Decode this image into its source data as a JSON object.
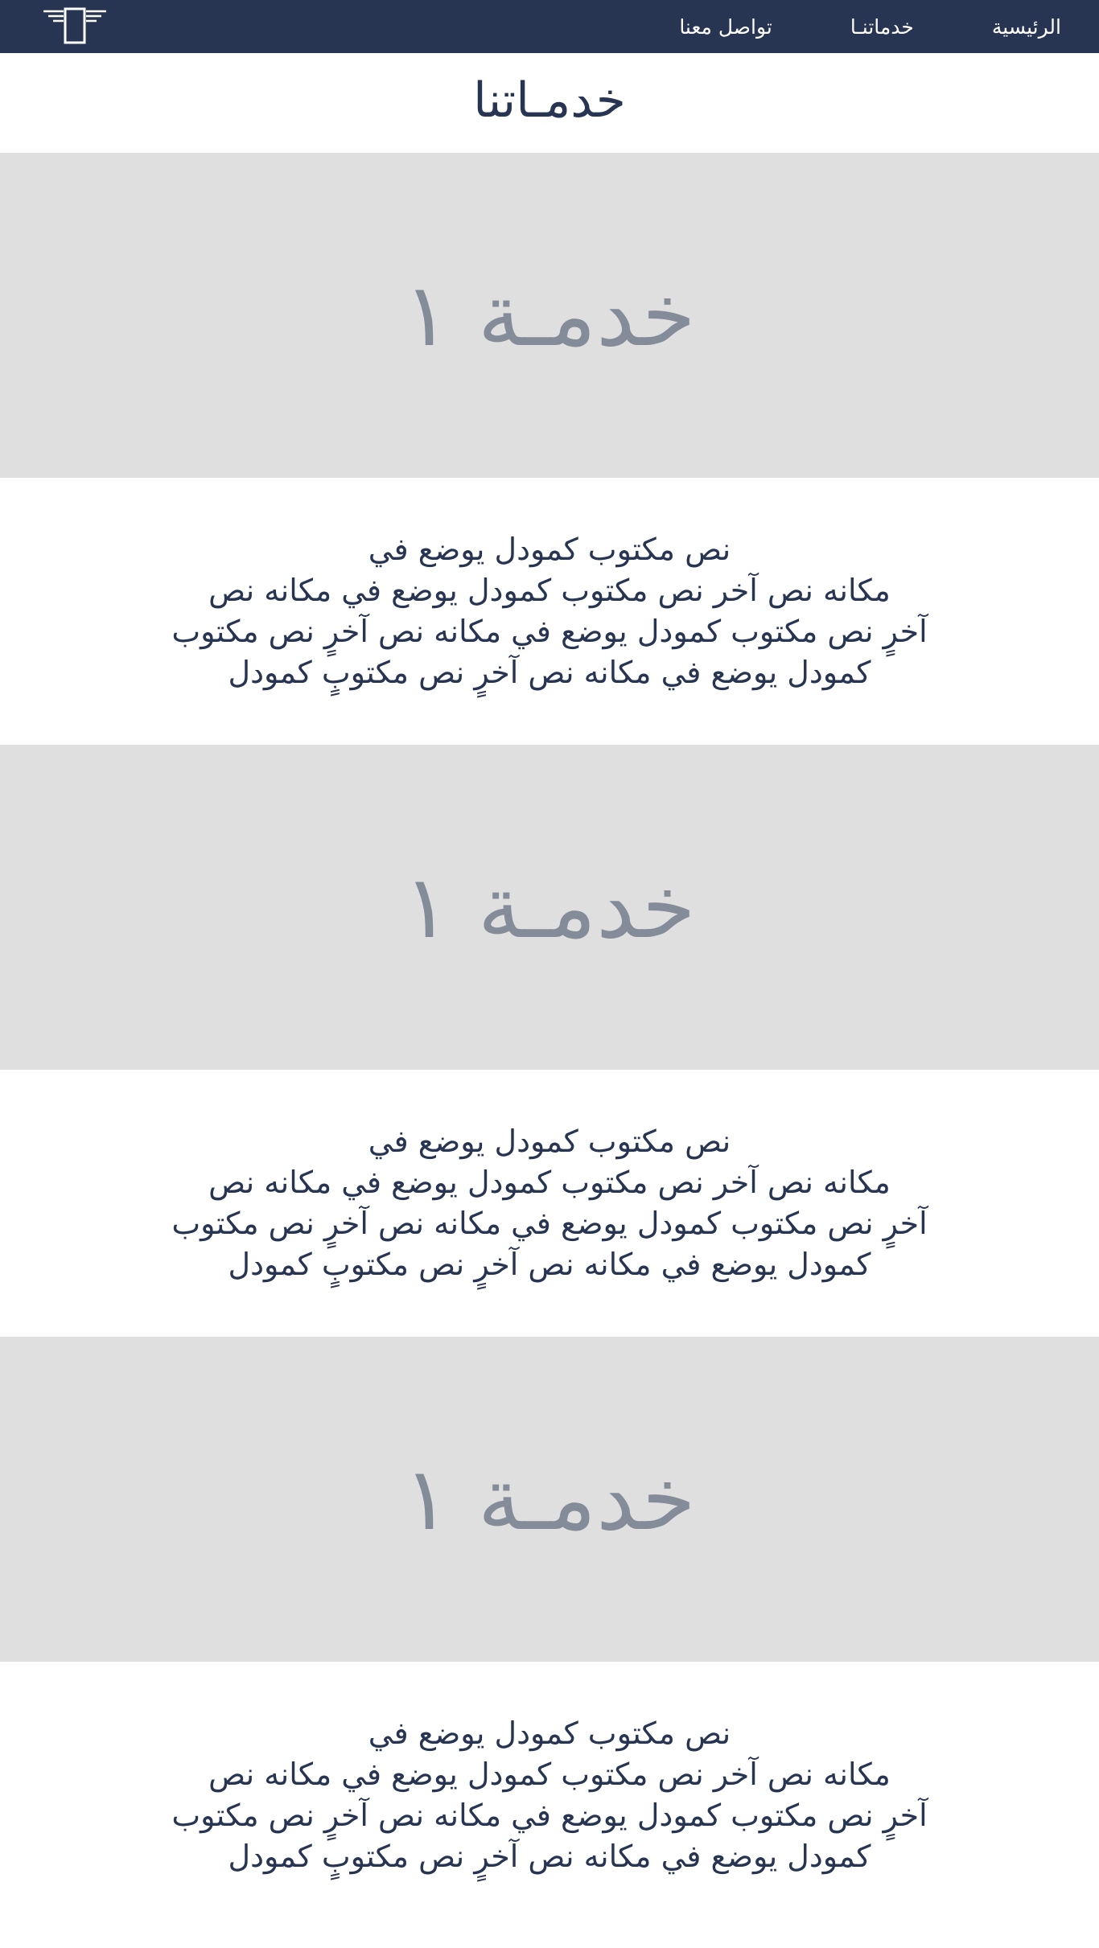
{
  "nav": {
    "items": [
      {
        "label": "الرئيسية"
      },
      {
        "label": "خدماتنـا"
      },
      {
        "label": "تواصل معنا"
      }
    ]
  },
  "page": {
    "title": "خدمـاتنا"
  },
  "services": [
    {
      "banner": "خدمـة ١",
      "lines": [
        "نص مكتوب كمودل يوضع في",
        "مكانه نص آخر نص مكتوب كمودل يوضع في مكانه نص",
        "آخرٍ نص مكتوب كمودل يوضع في مكانه نص آخرٍ نص مكتوب",
        "كمودل يوضع في مكانه نص آخرٍ نص مكتوبٍ كمودل"
      ]
    },
    {
      "banner": "خدمـة ١",
      "lines": [
        "نص مكتوب كمودل يوضع في",
        "مكانه نص آخر نص مكتوب كمودل يوضع في مكانه نص",
        "آخرٍ نص مكتوب كمودل يوضع في مكانه نص آخرٍ نص مكتوب",
        "كمودل يوضع في مكانه نص آخرٍ نص مكتوبٍ كمودل"
      ]
    },
    {
      "banner": "خدمـة ١",
      "lines": [
        "نص مكتوب كمودل يوضع في",
        "مكانه نص آخر نص مكتوب كمودل يوضع في مكانه نص",
        "آخرٍ نص مكتوب كمودل يوضع في مكانه نص آخرٍ نص مكتوب",
        "كمودل يوضع في مكانه نص آخرٍ نص مكتوبٍ كمودل"
      ]
    }
  ],
  "colors": {
    "navbar": "#283552",
    "banner_bg": "#dfdfdf",
    "banner_text": "#858c99",
    "body_text": "#283552"
  },
  "icons": {
    "logo": "winged-phone-icon"
  }
}
